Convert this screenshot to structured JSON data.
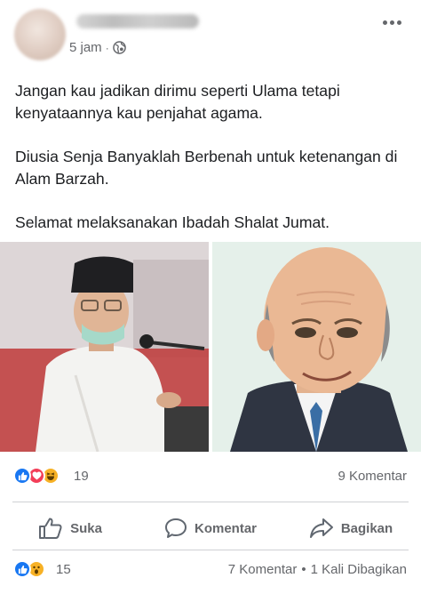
{
  "post": {
    "timestamp": "5 jam",
    "separator": "·",
    "paragraphs": [
      "Jangan kau jadikan dirimu seperti Ulama tetapi kenyataannya kau penjahat agama.",
      "Diusia Senja Banyaklah Berbenah untuk ketenangan di Alam Barzah.",
      "Selamat melaksanakan Ibadah Shalat Jumat."
    ]
  },
  "reactions": {
    "icons": [
      "like-icon",
      "love-icon",
      "haha-icon"
    ],
    "count": "19",
    "comments": "9 Komentar"
  },
  "actions": {
    "like": "Suka",
    "comment": "Komentar",
    "share": "Bagikan"
  },
  "footer": {
    "icons": [
      "like-icon",
      "wow-icon"
    ],
    "count": "15",
    "comments": "7 Komentar",
    "separator": "•",
    "shares": "1 Kali Dibagikan"
  },
  "colors": {
    "like": "#1877f2",
    "love": "#f33e58",
    "haha": "#f7b125",
    "secondary_text": "#65676b",
    "divider": "#ced0d4"
  }
}
